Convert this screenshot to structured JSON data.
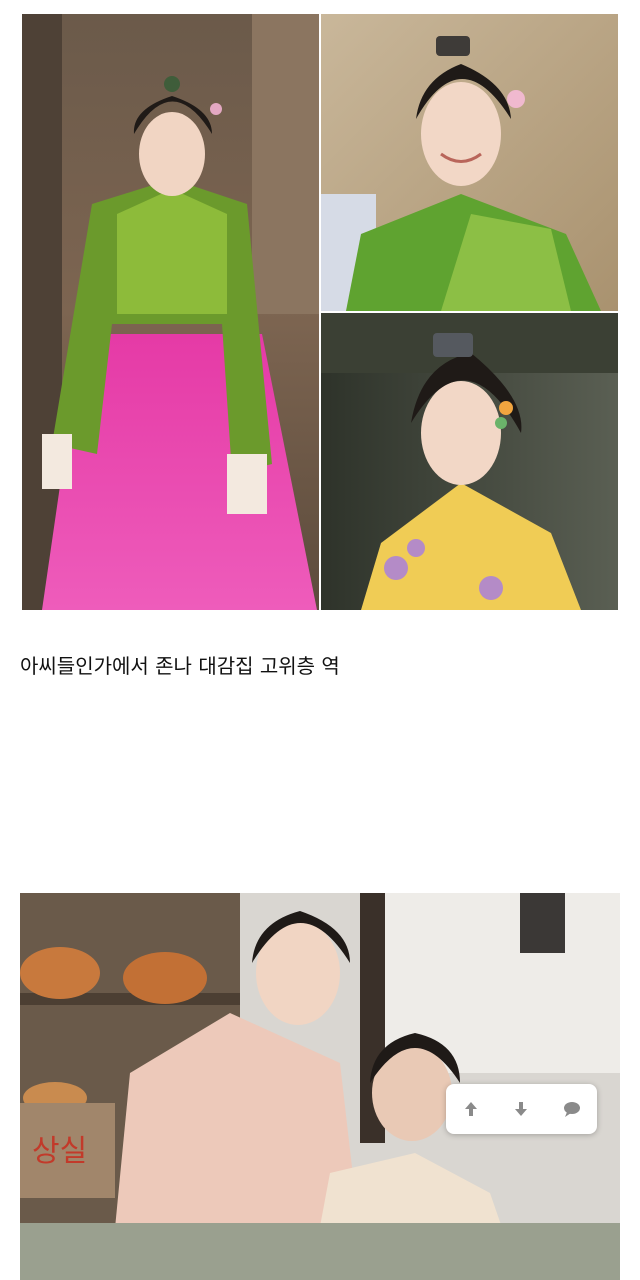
{
  "post": {
    "caption": "아씨들인가에서 존나 대감집 고위층 역"
  },
  "images": {
    "collage_left": {
      "subject": "woman-green-jeogori-pink-chima"
    },
    "collage_top_right": {
      "subject": "woman-green-jeogori-smiling"
    },
    "collage_bottom_right": {
      "subject": "woman-yellow-jeogori-profile"
    },
    "photo_2": {
      "subject": "woman-and-child-pink-hanbok",
      "sign_text": "상실"
    }
  },
  "toolbar": {
    "icons": [
      "arrow-up-icon",
      "arrow-down-icon",
      "comment-icon"
    ]
  },
  "colors": {
    "icon_gray": "#8a8a8a",
    "sign_red": "#c23a2a"
  }
}
